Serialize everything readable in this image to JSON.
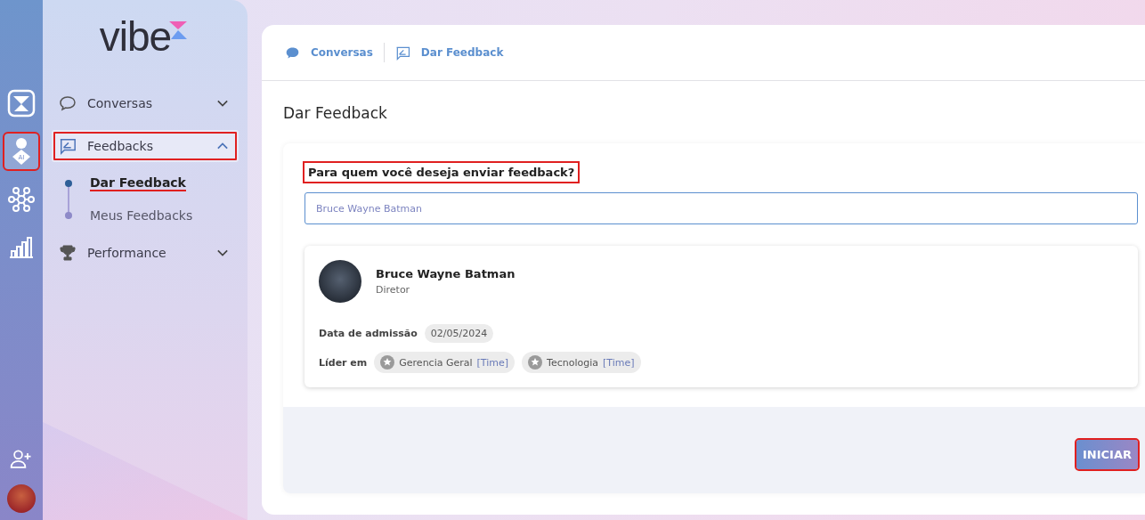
{
  "rail": {
    "items": [
      {
        "kind": "logo",
        "selected": false
      },
      {
        "kind": "person-ai",
        "selected": true,
        "label": "AI"
      },
      {
        "kind": "network",
        "selected": false
      },
      {
        "kind": "chart",
        "selected": false
      }
    ],
    "bottom": [
      {
        "kind": "add-user"
      },
      {
        "kind": "avatar"
      }
    ]
  },
  "sidebar": {
    "logo": "vibe",
    "items": [
      {
        "label": "Conversas",
        "kind": "chat",
        "expanded": false,
        "selected": false
      },
      {
        "label": "Feedbacks",
        "kind": "feedback",
        "expanded": true,
        "selected": true,
        "children": [
          {
            "label": "Dar Feedback",
            "selected": true
          },
          {
            "label": "Meus Feedbacks",
            "selected": false
          }
        ]
      },
      {
        "label": "Performance",
        "kind": "trophy",
        "expanded": false,
        "selected": false
      }
    ]
  },
  "breadcrumb": [
    {
      "label": "Conversas",
      "kind": "chat"
    },
    {
      "label": "Dar Feedback",
      "kind": "feedback"
    }
  ],
  "page_title": "Dar Feedback",
  "form": {
    "question": "Para quem você deseja enviar feedback?",
    "search": {
      "value": "Bruce Wayne Batman"
    },
    "person": {
      "name": "Bruce Wayne Batman",
      "role": "Diretor",
      "admission_label": "Data de admissão",
      "admission_date": "02/05/2024",
      "leader_label": "Líder em",
      "teams": [
        {
          "name": "Gerencia Geral",
          "tag": "[Time]"
        },
        {
          "name": "Tecnologia",
          "tag": "[Time]"
        }
      ]
    },
    "button": "INICIAR"
  }
}
